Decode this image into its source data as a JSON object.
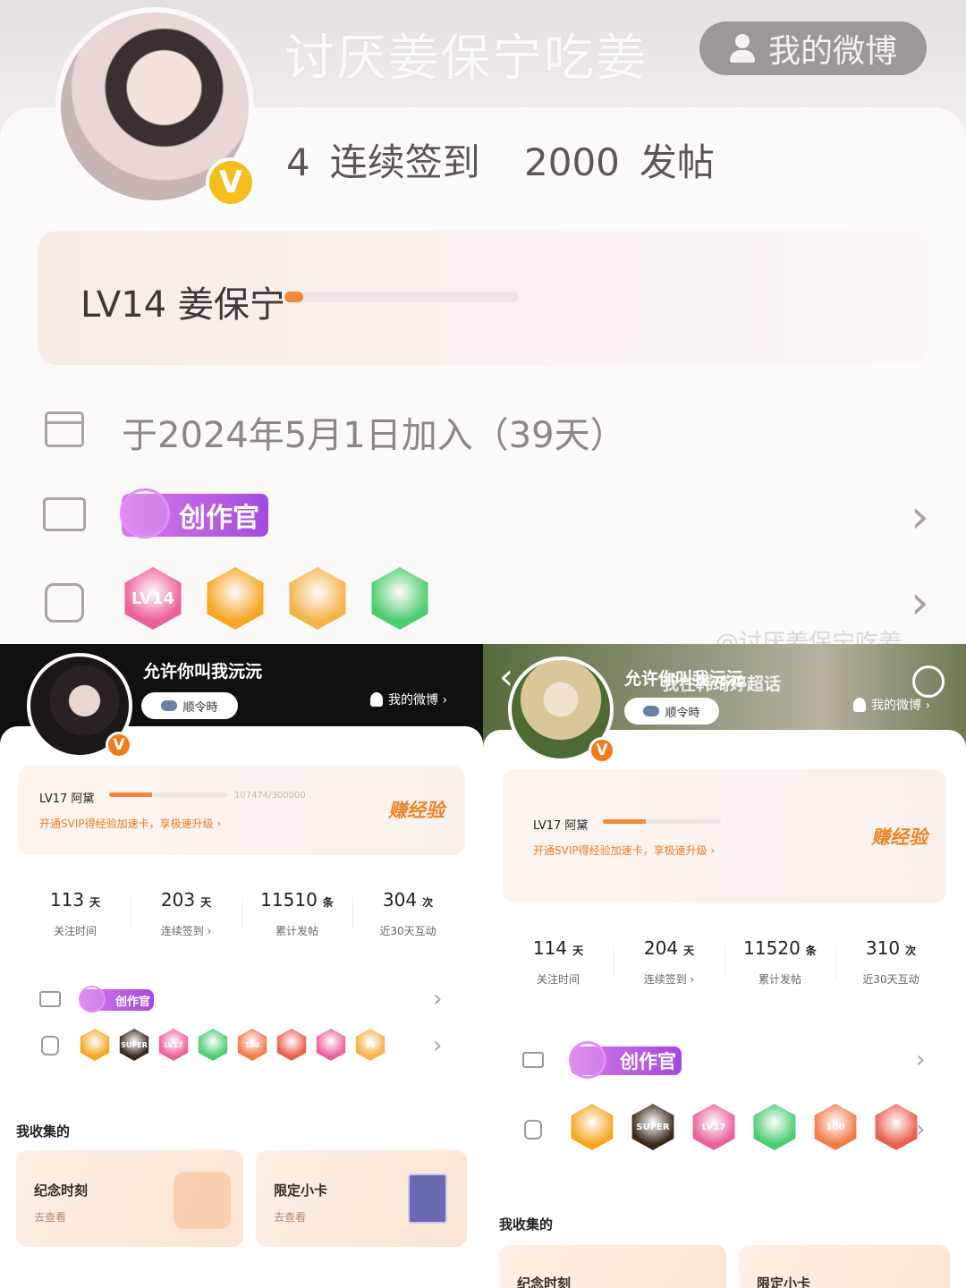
{
  "top": {
    "username": "讨厌姜保宁吃姜",
    "my_weibo": "我的微博",
    "v_badge": "V",
    "stats": [
      {
        "value": "4",
        "label": "连续签到"
      },
      {
        "value": "2000",
        "label": "发帖"
      }
    ],
    "level_text": "LV14 姜保宁",
    "level_progress": 0.08,
    "join_text": "于2024年5月1日加入（39天）",
    "creator_label": "创作官",
    "medals": [
      {
        "name": "lv14-medal",
        "text": "LV14",
        "color": "#ec5f9b"
      },
      {
        "name": "laugh-medal",
        "text": "",
        "color": "#f6a623"
      },
      {
        "name": "crown-medal",
        "text": "",
        "color": "#f5b24a"
      },
      {
        "name": "hand-medal",
        "text": "",
        "color": "#4ccc71"
      }
    ],
    "chevron": "›",
    "watermark": "@讨厌姜保宁吃姜"
  },
  "left": {
    "username": "允许你叫我沅沅",
    "tag": "顺令時",
    "my_weibo": "我的微博 ›",
    "v_badge": "V",
    "level_line": "LV17 阿黛",
    "level_progress": 0.36,
    "level_count": "107474/300000",
    "svip_tip": "开通SVIP得经验加速卡，享极速升级 ›",
    "earn": "赚经验",
    "stats": [
      {
        "num": "113",
        "unit": "天",
        "label": "关注时间"
      },
      {
        "num": "203",
        "unit": "天",
        "label": "连续签到 ›"
      },
      {
        "num": "11510",
        "unit": "条",
        "label": "累计发帖"
      },
      {
        "num": "304",
        "unit": "次",
        "label": "近30天互动"
      }
    ],
    "creator_label": "创作官",
    "medals": [
      {
        "text": "",
        "color": "#f6a623"
      },
      {
        "text": "SUPER",
        "color": "#3a2a1c"
      },
      {
        "text": "LV17",
        "color": "#ec5f9b"
      },
      {
        "text": "",
        "color": "#4ccc71"
      },
      {
        "text": "100",
        "color": "#f27b4a"
      },
      {
        "text": "",
        "color": "#e8604c"
      },
      {
        "text": "",
        "color": "#ec5f9b"
      },
      {
        "text": "30",
        "color": "#f5b24a"
      }
    ],
    "chevron": "›",
    "collection_title": "我收集的",
    "collections": [
      {
        "title": "纪念时刻",
        "sub": "去查看"
      },
      {
        "title": "限定小卡",
        "sub": "去查看"
      }
    ]
  },
  "right": {
    "username": "允许你叫我沅沅",
    "overlay_text": "我在韩琦婷超话",
    "tag": "顺令時",
    "my_weibo": "我的微博 ›",
    "back": "‹",
    "v_badge": "V",
    "level_line": "LV17 阿黛",
    "level_progress": 0.36,
    "svip_tip": "开通SVIP得经验加速卡，享极速升级 ›",
    "earn": "赚经验",
    "stats": [
      {
        "num": "114",
        "unit": "天",
        "label": "关注时间"
      },
      {
        "num": "204",
        "unit": "天",
        "label": "连续签到 ›"
      },
      {
        "num": "11520",
        "unit": "条",
        "label": "累计发帖"
      },
      {
        "num": "310",
        "unit": "次",
        "label": "近30天互动"
      }
    ],
    "creator_label": "创作官",
    "medals": [
      {
        "text": "",
        "color": "#f6a623"
      },
      {
        "text": "SUPER",
        "color": "#3a2a1c"
      },
      {
        "text": "LV17",
        "color": "#ec5f9b"
      },
      {
        "text": "",
        "color": "#4ccc71"
      },
      {
        "text": "100",
        "color": "#f27b4a"
      },
      {
        "text": "",
        "color": "#e8604c"
      }
    ],
    "chevron": "›",
    "collection_title": "我收集的",
    "collections": [
      {
        "title": "纪念时刻"
      },
      {
        "title": "限定小卡"
      }
    ]
  }
}
